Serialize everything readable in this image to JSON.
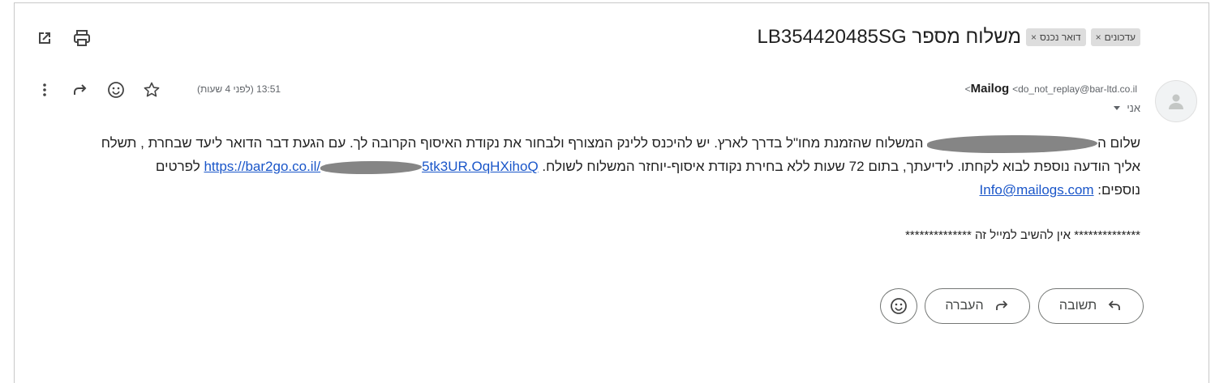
{
  "header": {
    "subject": "משלוח מספר LB354420485SG",
    "labels": [
      {
        "text": "דואר נכנס",
        "remove": "×"
      },
      {
        "text": "עדכונים",
        "remove": "×"
      }
    ]
  },
  "message": {
    "sender_name": "Mailog",
    "sender_email": "<do_not_replay@bar-ltd.co.il>",
    "recipient": "אני",
    "timestamp": "13:51 (לפני 4 שעות)",
    "body": {
      "line1": "שלום ה",
      "line1b": " המשלוח שהזמנת מחו\"ל בדרך לארץ. יש להיכנס ללינק המצורף ולבחור את נקודת האיסוף הקרובה לך. עם הגעת דבר הדואר ליעד שבחרת , תשלח",
      "line2": "אליך הודעה נוספת לבוא לקחתו. לידיעתך, בתום 72 שעות ללא בחירת נקודת איסוף-יוחזר המשלוח לשולח. ",
      "link1_start": "https://bar2go.co.il/",
      "link1_end": "5tk3UR.OqHXihoQ",
      "line2_suffix": " לפרטים",
      "line3_prefix": "נוספים: ",
      "email_link": "Info@mailogs.com",
      "no_reply": "************** אין להשיב למייל זה **************"
    }
  },
  "actions": {
    "reply_label": "תשובה",
    "forward_label": "העברה"
  },
  "icons": {
    "open_new_window": "open-in-new-icon",
    "print": "print-icon",
    "more": "more-vert-icon",
    "reply": "reply-icon",
    "emoji": "emoji-icon",
    "star": "star-icon",
    "avatar": "person-icon"
  }
}
